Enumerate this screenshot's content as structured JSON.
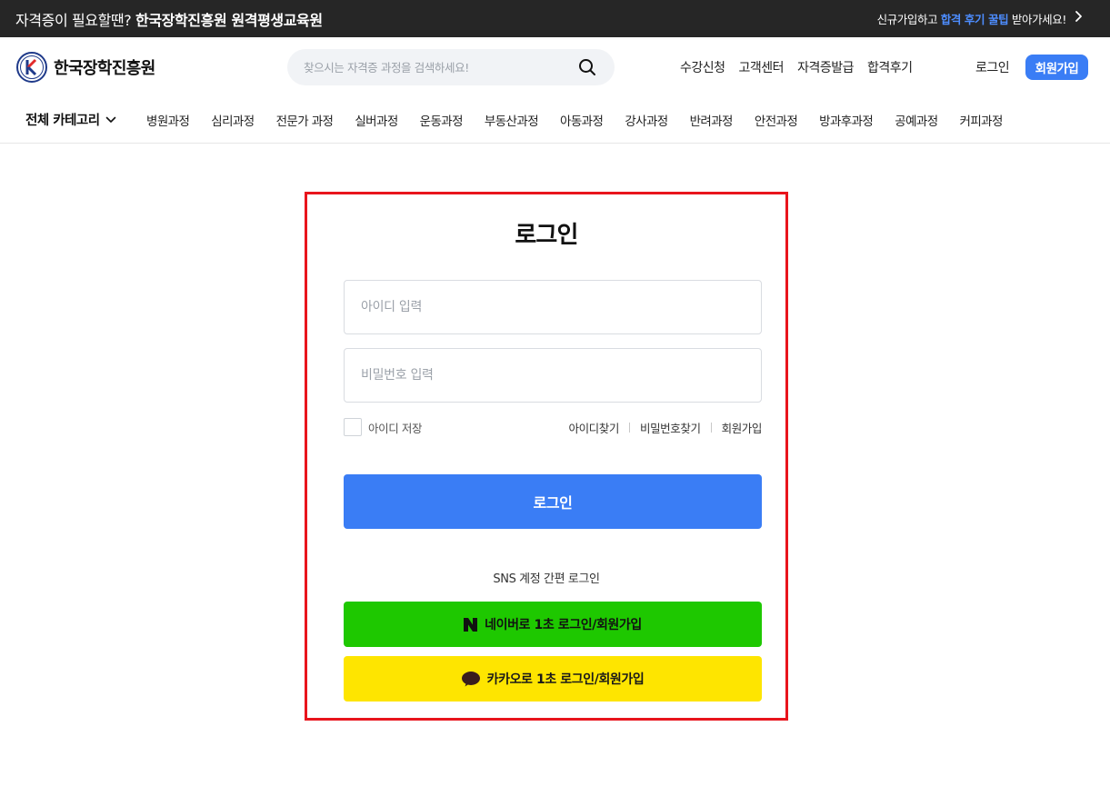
{
  "topbar": {
    "promo_prefix": "자격증이 필요할땐?",
    "promo_bold": "한국장학진흥원 원격평생교육원",
    "right_prefix": "신규가입하고",
    "right_highlight": "합격 후기 꿀팁",
    "right_suffix": "받아가세요!"
  },
  "header": {
    "logo_text": "한국장학진흥원",
    "search_placeholder": "찾으시는 자격증 과정을 검색하세요!",
    "util_nav": [
      "수강신청",
      "고객센터",
      "자격증발급",
      "합격후기"
    ],
    "login_label": "로그인",
    "join_label": "회원가입"
  },
  "category_nav": {
    "all_label": "전체 카테고리",
    "items": [
      "병원과정",
      "심리과정",
      "전문가 과정",
      "실버과정",
      "운동과정",
      "부동산과정",
      "아동과정",
      "강사과정",
      "반려과정",
      "안전과정",
      "방과후과정",
      "공예과정",
      "커피과정"
    ]
  },
  "login": {
    "title": "로그인",
    "id_placeholder": "아이디 입력",
    "pw_placeholder": "비밀번호 입력",
    "remember_label": "아이디 저장",
    "find_id": "아이디찾기",
    "find_pw": "비밀번호찾기",
    "signup": "회원가입",
    "submit_label": "로그인",
    "sns_title": "SNS 계정 간편 로그인",
    "naver_label": "네이버로 1초 로그인/회원가입",
    "kakao_label": "카카오로 1초 로그인/회원가입"
  },
  "colors": {
    "accent": "#3a7df5",
    "topbar_bg": "#262626",
    "highlight_border": "#e8141c",
    "naver": "#1ec800",
    "kakao": "#fee500"
  },
  "icons": {
    "logo": "k-emblem-icon",
    "search": "search-icon",
    "chevron": "chevron-right-icon",
    "dropdown": "chevron-down-icon",
    "naver": "naver-n-icon",
    "kakao": "kakao-bubble-icon"
  }
}
